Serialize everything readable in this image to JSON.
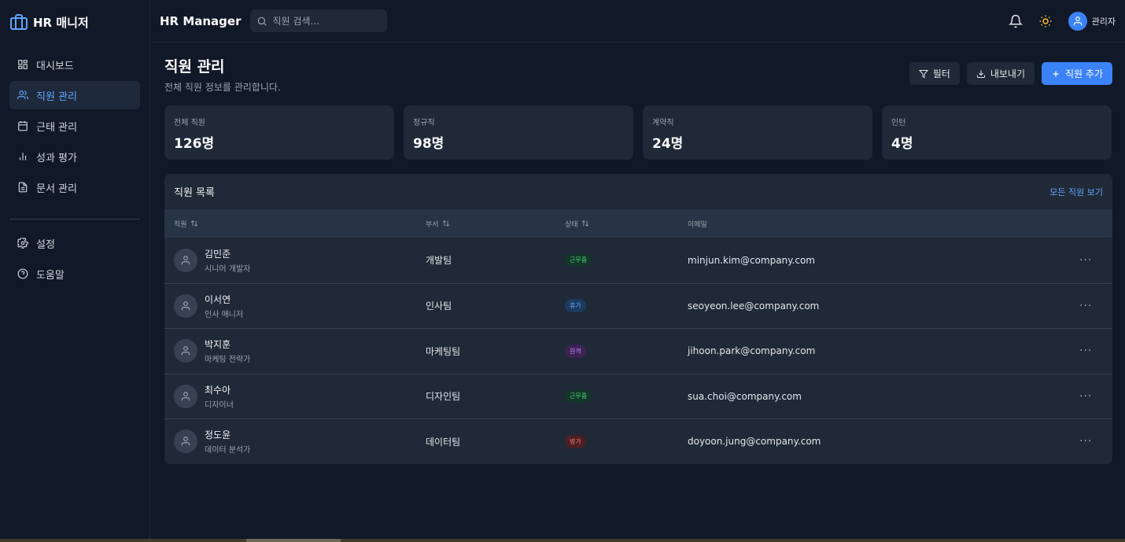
{
  "sidebar": {
    "brand": "HR 매니저",
    "items": [
      {
        "label": "대시보드"
      },
      {
        "label": "직원 관리"
      },
      {
        "label": "근태 관리"
      },
      {
        "label": "성과 평가"
      },
      {
        "label": "문서 관리"
      }
    ],
    "bottom_items": [
      {
        "label": "설정"
      },
      {
        "label": "도움말"
      }
    ]
  },
  "header": {
    "title": "HR Manager",
    "search_placeholder": "직원 검색...",
    "user_name": "관리자"
  },
  "page": {
    "title": "직원 관리",
    "subtitle": "전체 직원 정보를 관리합니다.",
    "filter_label": "필터",
    "export_label": "내보내기",
    "add_label": "직원 추가"
  },
  "stats": [
    {
      "label": "전체 직원",
      "value": "126명"
    },
    {
      "label": "정규직",
      "value": "98명"
    },
    {
      "label": "계약직",
      "value": "24명"
    },
    {
      "label": "인턴",
      "value": "4명"
    }
  ],
  "table": {
    "title": "직원 목록",
    "view_all": "모든 직원 보기",
    "columns": [
      "직원",
      "부서",
      "상태",
      "이메일"
    ],
    "rows": [
      {
        "name": "김민준",
        "role": "시니어 개발자",
        "dept": "개발팀",
        "status": "근무중",
        "email": "minjun.kim@company.com"
      },
      {
        "name": "이서연",
        "role": "인사 매니저",
        "dept": "인사팀",
        "status": "휴가",
        "email": "seoyeon.lee@company.com"
      },
      {
        "name": "박지훈",
        "role": "마케팅 전략가",
        "dept": "마케팅팀",
        "status": "원격",
        "email": "jihoon.park@company.com"
      },
      {
        "name": "최수아",
        "role": "디자이너",
        "dept": "디자인팀",
        "status": "근무중",
        "email": "sua.choi@company.com"
      },
      {
        "name": "정도윤",
        "role": "데이터 분석가",
        "dept": "데이터팀",
        "status": "병가",
        "email": "doyoon.jung@company.com"
      }
    ]
  },
  "status_colors": {
    "근무중": {
      "fg": "#4ade80",
      "bg": "#14352a"
    },
    "휴가": {
      "fg": "#60a5fa",
      "bg": "#1e3a5f"
    },
    "원격": {
      "fg": "#c084fc",
      "bg": "#3b2452"
    },
    "병가": {
      "fg": "#f87171",
      "bg": "#4a1f24"
    }
  },
  "colors": {
    "accent": "#3b82f6",
    "background": "#111827",
    "surface": "#1f2937"
  }
}
